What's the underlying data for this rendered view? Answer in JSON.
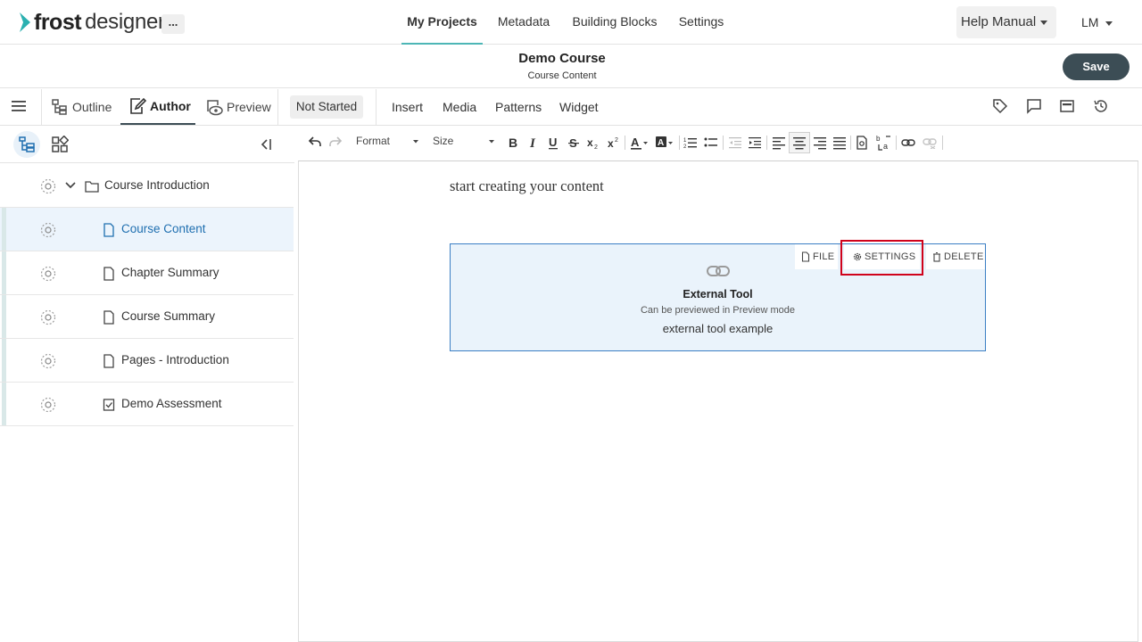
{
  "app": {
    "logo_bold": "frost",
    "logo_light": "designer",
    "more_label": "..."
  },
  "nav": {
    "tabs": [
      {
        "label": "My Projects",
        "active": true
      },
      {
        "label": "Metadata"
      },
      {
        "label": "Building Blocks"
      },
      {
        "label": "Settings"
      }
    ],
    "help_label": "Help Manual",
    "user_initials": "LM"
  },
  "course": {
    "title": "Demo Course",
    "subtitle": "Course Content",
    "save_label": "Save"
  },
  "modebar": {
    "outline_label": "Outline",
    "author_label": "Author",
    "preview_label": "Preview",
    "status_label": "Not Started",
    "insert_items": [
      "Insert",
      "Media",
      "Patterns",
      "Widget"
    ]
  },
  "tree": {
    "items": [
      {
        "label": "Course Introduction",
        "type": "folder"
      },
      {
        "label": "Course Content",
        "type": "page",
        "selected": true
      },
      {
        "label": "Chapter Summary",
        "type": "page"
      },
      {
        "label": "Course Summary",
        "type": "page"
      },
      {
        "label": "Pages - Introduction",
        "type": "page"
      },
      {
        "label": "Demo Assessment",
        "type": "assessment"
      }
    ]
  },
  "editor_toolbar": {
    "format_label": "Format",
    "size_label": "Size"
  },
  "editor": {
    "placeholder": "start creating your content",
    "widget": {
      "file_label": "FILE",
      "settings_label": "SETTINGS",
      "delete_label": "DELETE",
      "title": "External Tool",
      "subtitle": "Can be previewed in Preview mode",
      "description": "external tool example"
    }
  },
  "colors": {
    "accent": "#4db6b6",
    "save_bg": "#3c4d55",
    "selected_text": "#1f6fb0",
    "highlight": "#d0021b",
    "widget_border": "#3b7fc4"
  }
}
